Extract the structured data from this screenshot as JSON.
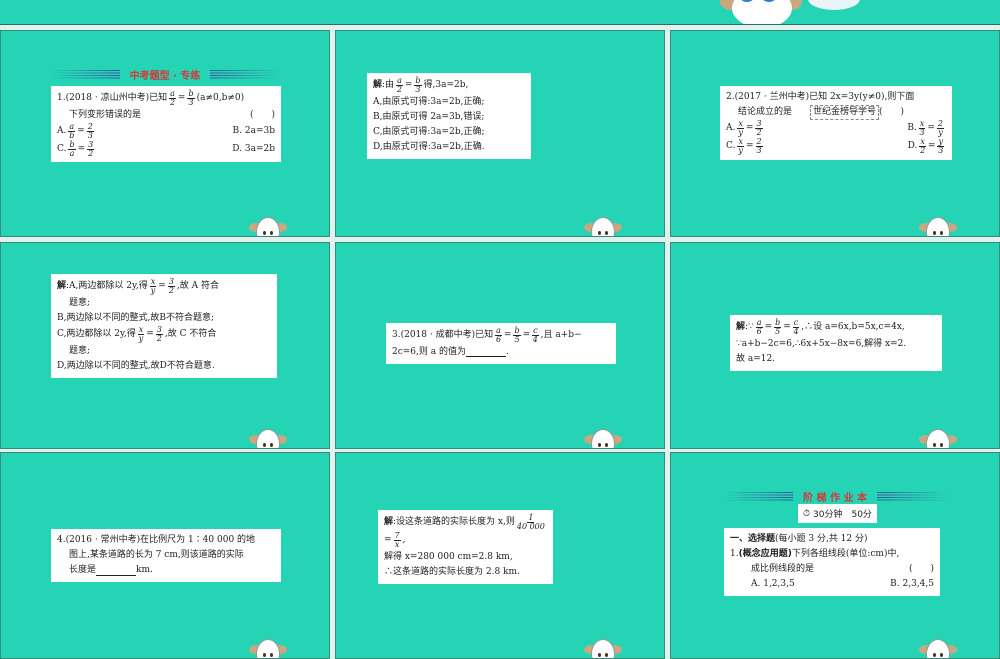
{
  "colors": {
    "slide_bg": "#24d4b4",
    "header_red": "#d23a3a",
    "page_bg": "#dff2ee"
  },
  "slides": [
    {
      "header": "中考题型 · 专练",
      "lines": [
        [
          {
            "t": "1.(2018 · 凉山州中考)已知"
          },
          {
            "n": "a",
            "d": "2"
          },
          {
            "t": "="
          },
          {
            "n": "b",
            "d": "3"
          },
          {
            "t": "(a≠0,b≠0)"
          }
        ],
        [
          {
            "t": "下列变形错误的是"
          },
          {
            "gap": "1"
          },
          {
            "t": "(　　)"
          }
        ],
        [
          {
            "t": "A."
          },
          {
            "n": "a",
            "d": "b"
          },
          {
            "t": "="
          },
          {
            "n": "2",
            "d": "3"
          },
          {
            "gap": "1"
          },
          {
            "t": "B. 2a=3b"
          }
        ],
        [
          {
            "t": "C."
          },
          {
            "n": "b",
            "d": "a"
          },
          {
            "t": "="
          },
          {
            "n": "3",
            "d": "2"
          },
          {
            "gap": "1"
          },
          {
            "t": "D. 3a=2b"
          }
        ]
      ]
    },
    {
      "lines": [
        [
          {
            "b": "解"
          },
          {
            "t": ":由"
          },
          {
            "n": "a",
            "d": "2"
          },
          {
            "t": "="
          },
          {
            "n": "b",
            "d": "3"
          },
          {
            "t": "得,3a=2b,"
          }
        ],
        [
          {
            "t": "A,由原式可得:3a=2b,正确;"
          }
        ],
        [
          {
            "t": "B,由原式可得 2a=3b,错误;"
          }
        ],
        [
          {
            "t": "C,由原式可得:3a=2b,正确;"
          }
        ],
        [
          {
            "t": "D,由原式可得:3a=2b,正确."
          }
        ]
      ]
    },
    {
      "lines": [
        [
          {
            "t": "2.(2017 · 兰州中考)已知 2x=3y(y≠0),则下面"
          }
        ],
        [
          {
            "t": "结论成立的是"
          },
          {
            "dot": "世纪金榜导学号"
          },
          {
            "t": "(　　)"
          }
        ],
        [
          {
            "t": "A."
          },
          {
            "n": "x",
            "d": "y"
          },
          {
            "t": "="
          },
          {
            "n": "3",
            "d": "2"
          },
          {
            "gap": "1"
          },
          {
            "t": "B."
          },
          {
            "n": "x",
            "d": "3"
          },
          {
            "t": "="
          },
          {
            "n": "2",
            "d": "y"
          }
        ],
        [
          {
            "t": "C."
          },
          {
            "n": "x",
            "d": "y"
          },
          {
            "t": "="
          },
          {
            "n": "2",
            "d": "3"
          },
          {
            "gap": "1"
          },
          {
            "t": "D."
          },
          {
            "n": "x",
            "d": "2"
          },
          {
            "t": "="
          },
          {
            "n": "y",
            "d": "3"
          }
        ]
      ]
    },
    {
      "lines": [
        [
          {
            "b": "解"
          },
          {
            "t": ":A,两边都除以 2y,得"
          },
          {
            "n": "x",
            "d": "y"
          },
          {
            "t": "="
          },
          {
            "n": "3",
            "d": "2"
          },
          {
            "t": ",故 A 符合"
          }
        ],
        [
          {
            "t": "题意;"
          }
        ],
        [
          {
            "t": "B,两边除以不同的整式,故B不符合题意;"
          }
        ],
        [
          {
            "t": "C,两边都除以 2y,得"
          },
          {
            "n": "x",
            "d": "y"
          },
          {
            "t": "="
          },
          {
            "n": "3",
            "d": "2"
          },
          {
            "t": ",故 C 不符合"
          }
        ],
        [
          {
            "t": "题意;"
          }
        ],
        [
          {
            "t": "D,两边除以不同的整式,故D不符合题意."
          }
        ]
      ]
    },
    {
      "lines": [
        [
          {
            "t": "3.(2018 · 成都中考)已知"
          },
          {
            "n": "a",
            "d": "6"
          },
          {
            "t": "="
          },
          {
            "n": "b",
            "d": "5"
          },
          {
            "t": "="
          },
          {
            "n": "c",
            "d": "4"
          },
          {
            "t": ",且 a+b−"
          }
        ],
        [
          {
            "t": "2c=6,则 a 的值为"
          },
          {
            "blank": "1"
          },
          {
            "t": "."
          }
        ]
      ]
    },
    {
      "lines": [
        [
          {
            "b": "解"
          },
          {
            "t": ":∵"
          },
          {
            "n": "a",
            "d": "6"
          },
          {
            "t": "="
          },
          {
            "n": "b",
            "d": "5"
          },
          {
            "t": "="
          },
          {
            "n": "c",
            "d": "4"
          },
          {
            "t": ",∴设 a=6x,b=5x,c=4x,"
          }
        ],
        [
          {
            "t": "∵a+b−2c=6,∴6x+5x−8x=6,解得 x=2."
          }
        ],
        [
          {
            "t": "故 a=12."
          }
        ]
      ]
    },
    {
      "lines": [
        [
          {
            "t": "4.(2016 · 常州中考)在比例尺为 1∶40 000 的地"
          }
        ],
        [
          {
            "t": "图上,某条道路的长为 7 cm,则该道路的实际"
          }
        ],
        [
          {
            "t": "长度是"
          },
          {
            "blank": "1"
          },
          {
            "t": "km."
          }
        ]
      ]
    },
    {
      "lines": [
        [
          {
            "b": "解"
          },
          {
            "t": ":设这条道路的实际长度为 x,则"
          },
          {
            "n": "1",
            "d": "40 000"
          }
        ],
        [
          {
            "t": "="
          },
          {
            "n": "7",
            "d": "x"
          },
          {
            "t": ","
          }
        ],
        [
          {
            "t": "解得 x=280 000 cm=2.8 km,"
          }
        ],
        [
          {
            "t": "∴这条道路的实际长度为 2.8 km."
          }
        ]
      ]
    },
    {
      "header": "阶 梯 作 业 本",
      "badge": "30分钟　50分",
      "lines": [
        [
          {
            "b": "一、选择题"
          },
          {
            "t": "(每小题 3 分,共 12 分)"
          }
        ],
        [
          {
            "t": "1."
          },
          {
            "b": "(概念应用题)"
          },
          {
            "t": "下列各组线段(单位:cm)中,"
          }
        ],
        [
          {
            "t": "　成比例线段的是"
          },
          {
            "gap": "1"
          },
          {
            "t": "(　　)"
          }
        ],
        [
          {
            "t": "　A. 1,2,3,5"
          },
          {
            "gap": "1"
          },
          {
            "t": "B. 2,3,4,5"
          }
        ]
      ]
    }
  ]
}
